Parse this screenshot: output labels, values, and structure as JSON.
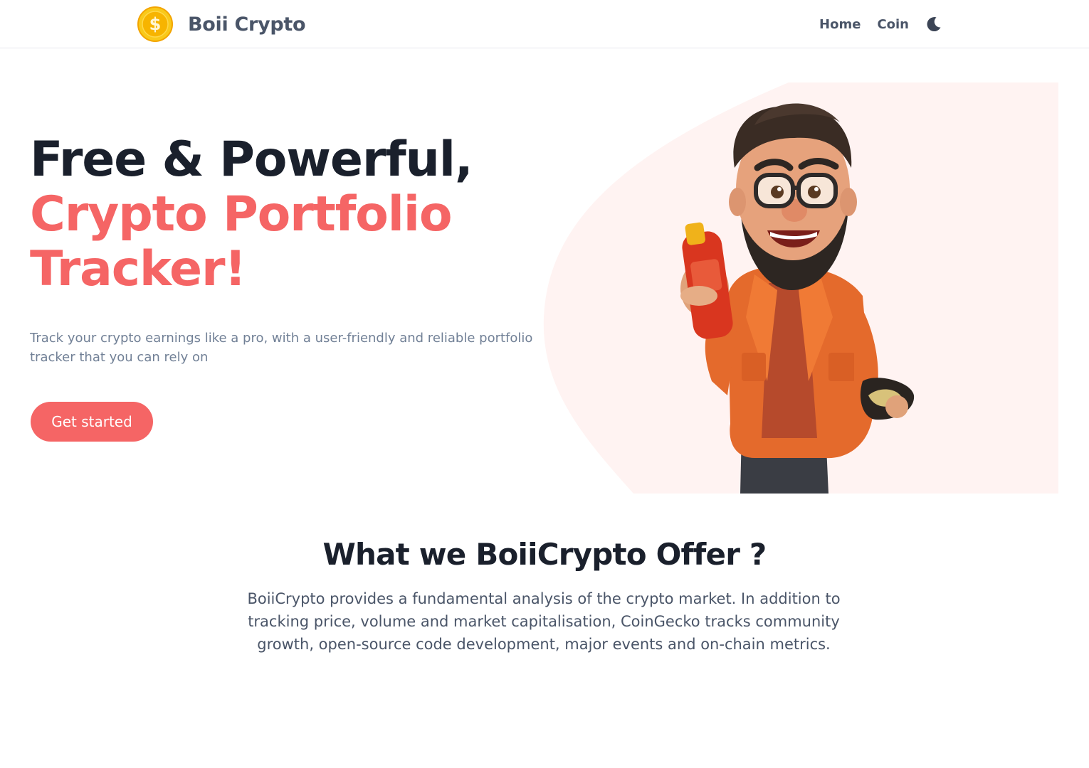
{
  "header": {
    "brand_name": "Boii Crypto",
    "logo_icon": "dollar-coin-icon",
    "nav": [
      {
        "label": "Home"
      },
      {
        "label": "Coin"
      }
    ],
    "theme_toggle_icon": "moon-icon"
  },
  "hero": {
    "title_line1": "Free & Powerful,",
    "title_line2": "Crypto Portfolio",
    "title_line3": "Tracker!",
    "description": "Track your crypto earnings like a pro, with a user-friendly and reliable portfolio tracker that you can rely on",
    "cta_label": "Get started",
    "illustration": "cartoon-bearded-man-holding-bottle-illustration"
  },
  "offer": {
    "title": "What we BoiiCrypto Offer ?",
    "description": "BoiiCrypto provides a fundamental analysis of the crypto market. In addition to tracking price, volume and market capitalisation, CoinGecko tracks community growth, open-source code development, major events and on-chain metrics."
  },
  "colors": {
    "accent": "#f56565",
    "heading": "#1a202c",
    "muted_text": "#718096",
    "nav_text": "#4a5568",
    "blob": "#fff3f2",
    "coin": "#f6b800"
  }
}
